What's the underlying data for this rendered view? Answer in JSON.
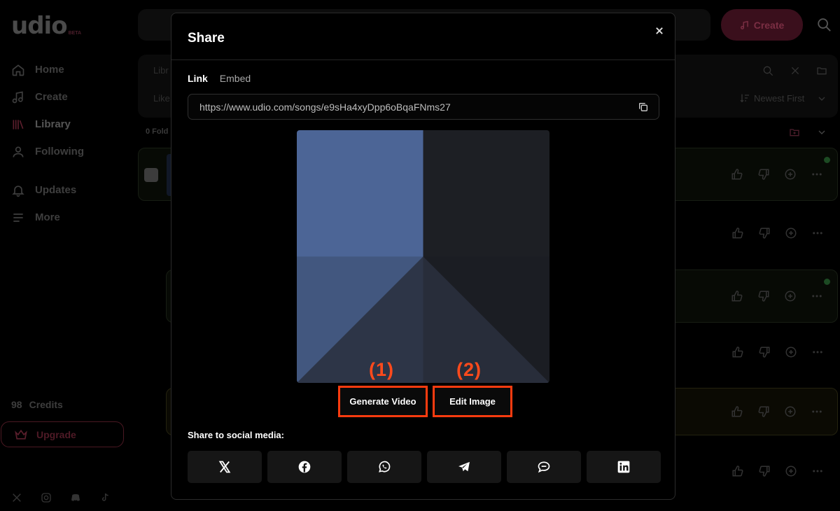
{
  "app": {
    "logo": "udio",
    "beta": "BETA",
    "nav": [
      {
        "label": "Home",
        "icon": "home-icon"
      },
      {
        "label": "Create",
        "icon": "music-note-icon"
      },
      {
        "label": "Library",
        "icon": "library-icon"
      },
      {
        "label": "Following",
        "icon": "person-icon"
      },
      {
        "label": "Updates",
        "icon": "bell-icon"
      },
      {
        "label": "More",
        "icon": "menu-icon"
      }
    ],
    "credits_count": "98",
    "credits_label": "Credits",
    "upgrade_label": "Upgrade",
    "create_button": "Create",
    "filter_text_1": "Libr",
    "filter_text_2": "Like",
    "sort_label": "Newest First",
    "folders_text": "0 Fold"
  },
  "modal": {
    "title": "Share",
    "tabs": [
      {
        "label": "Link",
        "active": true
      },
      {
        "label": "Embed",
        "active": false
      }
    ],
    "link_url": "https://www.udio.com/songs/e9sHa4xyDpp6oBqaFNms27",
    "annotation_1": "(1)",
    "annotation_2": "(2)",
    "generate_video_label": "Generate Video",
    "edit_image_label": "Edit Image",
    "social_title": "Share to social media:",
    "social_buttons": [
      "x-icon",
      "facebook-icon",
      "whatsapp-icon",
      "telegram-icon",
      "chat-bubble-icon",
      "linkedin-icon"
    ]
  },
  "colors": {
    "annotation": "#ff3b0f",
    "cover_blue": "#4c6596",
    "cover_dark": "#1d1f24"
  }
}
